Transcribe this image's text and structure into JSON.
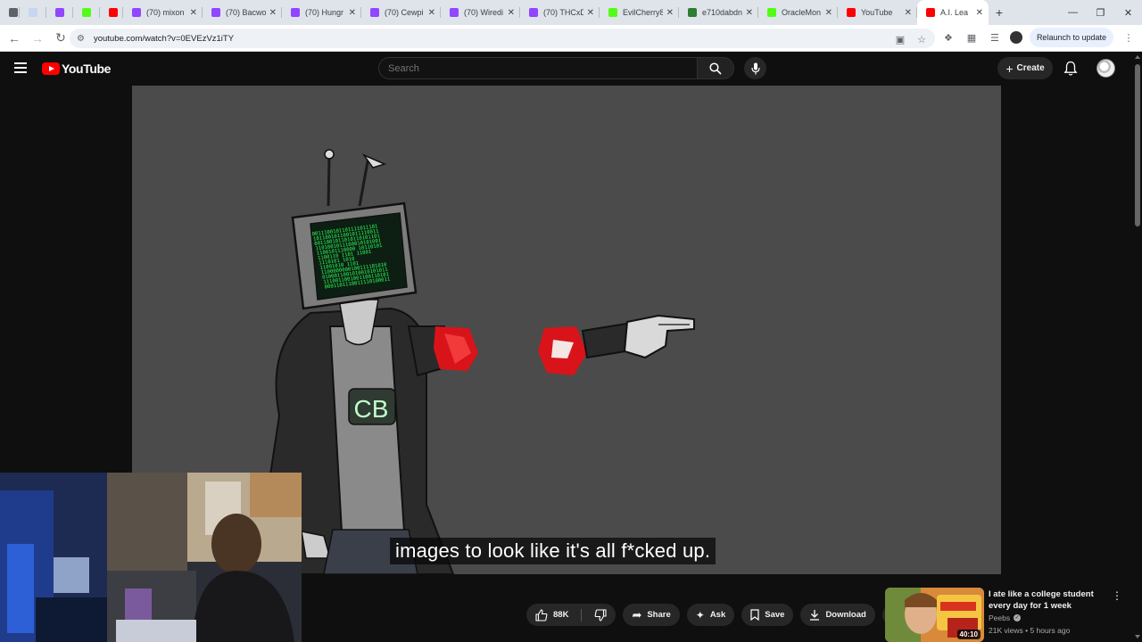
{
  "browser": {
    "tabs": [
      {
        "title": "",
        "color": "#5f6368"
      },
      {
        "title": "",
        "color": "#c7d6ef"
      },
      {
        "title": "",
        "color": "#9146ff"
      },
      {
        "title": "",
        "color": "#53fc18"
      },
      {
        "title": "",
        "color": "#ff0000"
      },
      {
        "title": "(70) mixon",
        "color": "#9146ff"
      },
      {
        "title": "(70) Bacwo",
        "color": "#9146ff"
      },
      {
        "title": "(70) Hungr",
        "color": "#9146ff"
      },
      {
        "title": "(70) Cewpi",
        "color": "#9146ff"
      },
      {
        "title": "(70) Wiredi",
        "color": "#9146ff"
      },
      {
        "title": "(70) THCxD",
        "color": "#9146ff"
      },
      {
        "title": "EvilCherry8",
        "color": "#53fc18"
      },
      {
        "title": "e710dabdn",
        "color": "#2e7d32"
      },
      {
        "title": "OracleMon",
        "color": "#53fc18"
      },
      {
        "title": "YouTube",
        "color": "#ff0000"
      },
      {
        "title": "A.I. Lea",
        "color": "#ff0000"
      }
    ],
    "new_tab": "+",
    "url": "youtube.com/watch?v=0EVEzVz1iTY",
    "relaunch_label": "Relaunch to update"
  },
  "youtube": {
    "logo_text": "YouTube",
    "search_placeholder": "Search",
    "create_label": "Create",
    "caption": "images to look like it's all f*cked up.",
    "likes": "88K",
    "share_label": "Share",
    "ask_label": "Ask",
    "save_label": "Save",
    "download_label": "Download",
    "recommendation": {
      "title": "I ate like a college student every day for 1 week",
      "channel": "Peebs",
      "meta": "21K views • 5 hours ago",
      "duration": "40:10"
    },
    "video_art": {
      "shirt_text": "CB",
      "screen_code": [
        "0011100101101111011101",
        "1011001011001011110011",
        "0011001011010110101101",
        "1101001011100010101001",
        "1100101110000 10110101",
        "1100110   1101 11001",
        "1110101        1010",
        "11001010         1101",
        "1100000000100111101010",
        "0100011001010010101011",
        "1110011001001100110101",
        "0001101110011110100011"
      ]
    },
    "colors": {
      "brand": "#ff0000",
      "background": "#0f0f0f",
      "pill": "#272727",
      "screen_green": "#2aff5a"
    }
  }
}
